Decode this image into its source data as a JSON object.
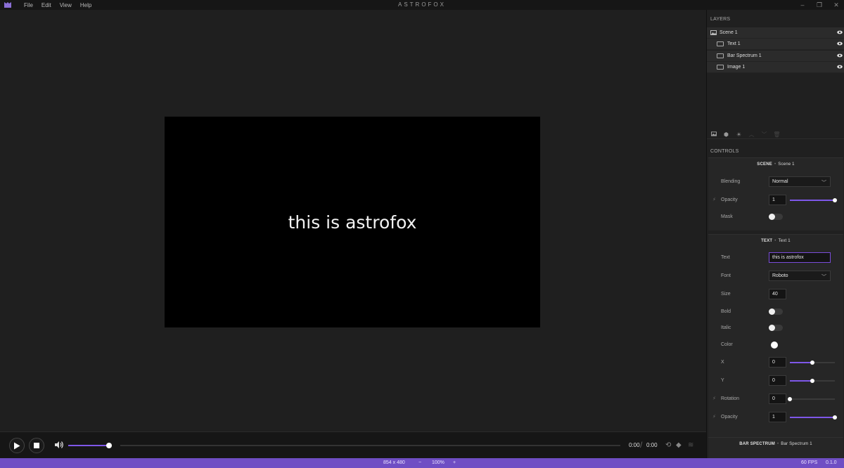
{
  "app": {
    "title": "ASTROFOX",
    "menu": [
      "File",
      "Edit",
      "View",
      "Help"
    ],
    "window_controls": [
      "–",
      "❐",
      "✕"
    ]
  },
  "stage": {
    "text": "this is astrofox"
  },
  "layers": {
    "title": "LAYERS",
    "items": [
      {
        "label": "Scene 1",
        "type": "scene"
      },
      {
        "label": "Text 1",
        "type": "element"
      },
      {
        "label": "Bar Spectrum 1",
        "type": "element"
      },
      {
        "label": "Image 1",
        "type": "element"
      }
    ]
  },
  "controls": {
    "title": "CONTROLS",
    "scene": {
      "kind": "SCENE",
      "name": "Scene 1",
      "blending_label": "Blending",
      "blending_value": "Normal",
      "opacity_label": "Opacity",
      "opacity_value": "1",
      "opacity_level": 1.0,
      "mask_label": "Mask",
      "mask_on": false
    },
    "text": {
      "kind": "TEXT",
      "name": "Text 1",
      "text_label": "Text",
      "text_value": "this is astrofox",
      "font_label": "Font",
      "font_value": "Roboto",
      "size_label": "Size",
      "size_value": "40",
      "bold_label": "Bold",
      "italic_label": "Italic",
      "color_label": "Color",
      "color_value": "#ffffff",
      "x_label": "X",
      "x_value": "0",
      "x_level": 0.5,
      "y_label": "Y",
      "y_value": "0",
      "y_level": 0.5,
      "rotation_label": "Rotation",
      "rotation_value": "0",
      "rotation_level": 0.0,
      "opacity_label": "Opacity",
      "opacity_value": "1",
      "opacity_level": 1.0
    },
    "bar_spectrum": {
      "kind": "BAR SPECTRUM",
      "name": "Bar Spectrum 1"
    }
  },
  "player": {
    "current_time": "0:00",
    "total_time": "0:00",
    "volume_level": 0.97
  },
  "status": {
    "resolution": "854 x 480",
    "zoom_minus": "−",
    "zoom": "100%",
    "zoom_plus": "+",
    "fps": "60 FPS",
    "version": "0.1.0"
  },
  "colors": {
    "accent": "#7e57e8",
    "statusbar": "#6f4ec4"
  }
}
